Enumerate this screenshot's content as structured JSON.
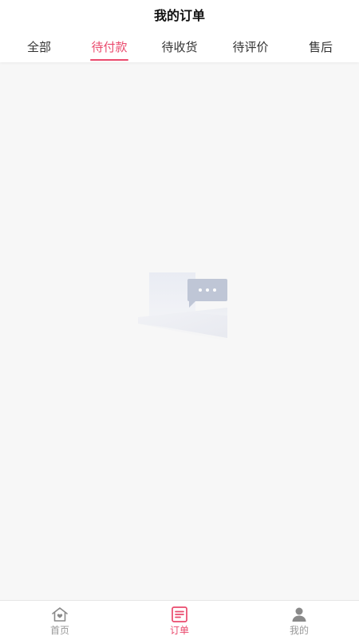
{
  "header": {
    "title": "我的订单"
  },
  "tabs": [
    {
      "label": "全部",
      "active": false
    },
    {
      "label": "待付款",
      "active": true
    },
    {
      "label": "待收货",
      "active": false
    },
    {
      "label": "待评价",
      "active": false
    },
    {
      "label": "售后",
      "active": false
    }
  ],
  "empty_state": {
    "icon": "empty-box-message-icon"
  },
  "tabbar": {
    "items": [
      {
        "label": "首页",
        "icon": "home-icon",
        "active": false
      },
      {
        "label": "订单",
        "icon": "order-icon",
        "active": true
      },
      {
        "label": "我的",
        "icon": "user-icon",
        "active": false
      }
    ]
  },
  "colors": {
    "accent": "#ea4a6d",
    "inactive": "#999999",
    "background": "#f7f7f7"
  }
}
